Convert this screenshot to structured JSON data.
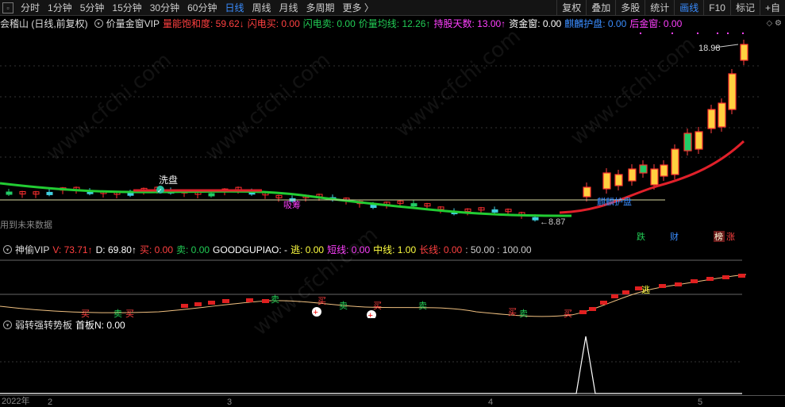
{
  "toolbar": {
    "timeframes": [
      "分时",
      "1分钟",
      "5分钟",
      "15分钟",
      "30分钟",
      "60分钟",
      "日线",
      "周线",
      "月线",
      "多周期",
      "更多 〉"
    ],
    "active": "日线",
    "right": [
      "复权",
      "叠加",
      "多股",
      "统计",
      "画线",
      "F10",
      "标记",
      "+自"
    ]
  },
  "main_legend": {
    "stock": "会稽山 (日线,前复权)",
    "indicator": "价量金窗VIP",
    "items": [
      {
        "label": "量能饱和度: 59.62↓",
        "color": "#ff4040"
      },
      {
        "label": "闪电买: 0.00",
        "color": "#ff4040"
      },
      {
        "label": "闪电卖: 0.00",
        "color": "#22cc55"
      },
      {
        "label": "价量均线: 12.26↑",
        "color": "#22cc55"
      },
      {
        "label": "持股天数: 13.00↑",
        "color": "#ff40ff"
      },
      {
        "label": "资金窗: 0.00",
        "color": "#ffffff"
      },
      {
        "label": "麒麟护盘: 0.00",
        "color": "#3a8dff"
      },
      {
        "label": "后金窗: 0.00",
        "color": "#ff40ff"
      }
    ]
  },
  "main_chart": {
    "high_label": "18.98",
    "low_label": "8.87",
    "xipan": "洗盘",
    "text_qilin": "麒麟护盘",
    "text_mid": "吸筹",
    "future_text": "用到未来数据",
    "markers": [
      "跌",
      "财",
      "榜",
      "涨"
    ]
  },
  "sub1_legend": {
    "indicator": "神偷VIP",
    "items": [
      {
        "label": "V: 73.71↑",
        "color": "#ff4040"
      },
      {
        "label": "D: 69.80↑",
        "color": "#ffffff"
      },
      {
        "label": "买: 0.00",
        "color": "#ff4040"
      },
      {
        "label": "卖: 0.00",
        "color": "#22cc55"
      },
      {
        "label": "GOODGUPIAO: -",
        "color": "#ffffff"
      },
      {
        "label": "逃: 0.00",
        "color": "#ffff40"
      },
      {
        "label": "短线: 0.00",
        "color": "#ff40ff"
      },
      {
        "label": "中线: 1.00",
        "color": "#ffff40"
      },
      {
        "label": "长线: 0.00",
        "color": "#ff4040"
      },
      {
        "label": ": 50.00 : 100.00",
        "color": "#cccccc"
      }
    ]
  },
  "sub1_chart": {
    "buy_labels": [
      "买",
      "买",
      "买",
      "买",
      "买",
      "买"
    ],
    "sell_labels": [
      "卖",
      "卖",
      "卖",
      "卖",
      "卖"
    ],
    "escape": "逃"
  },
  "sub2_legend": {
    "indicator": "弱转强转势板",
    "items": [
      {
        "label": "首板N: 0.00",
        "color": "#ffffff"
      }
    ]
  },
  "xaxis": [
    "2022年",
    "2",
    "3",
    "4",
    "5"
  ],
  "watermark": "www.cfchi.com"
}
